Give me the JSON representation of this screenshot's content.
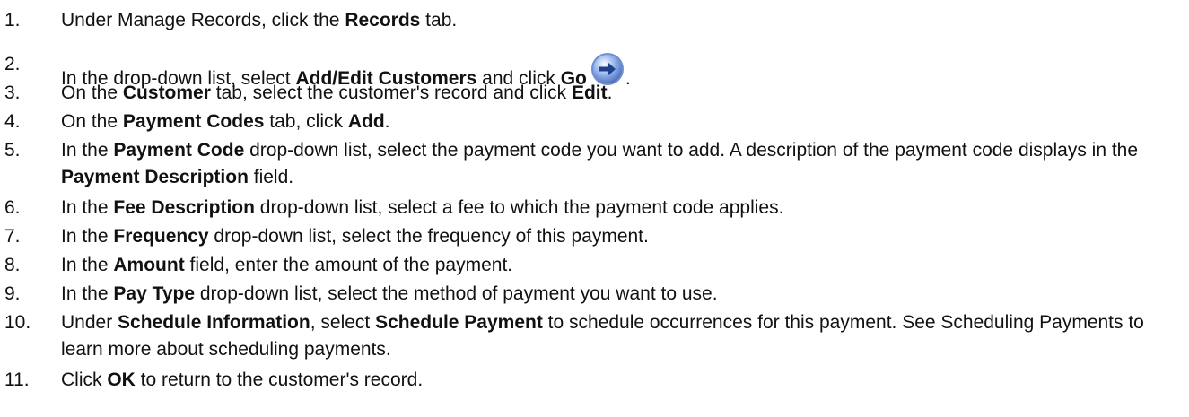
{
  "steps": [
    {
      "number": "1.",
      "parts": [
        {
          "text": "Under Manage Records, click the ",
          "bold": false
        },
        {
          "text": "Records",
          "bold": true
        },
        {
          "text": " tab.",
          "bold": false
        }
      ]
    },
    {
      "number": "2.",
      "parts": [
        {
          "text": "In the drop-down list, select ",
          "bold": false
        },
        {
          "text": "Add/Edit Customers",
          "bold": true
        },
        {
          "text": " and click ",
          "bold": false
        },
        {
          "text": "Go",
          "bold": true
        },
        {
          "icon": "go-arrow-icon"
        },
        {
          "text": ".",
          "bold": false
        }
      ]
    },
    {
      "number": "3.",
      "parts": [
        {
          "text": "On the ",
          "bold": false
        },
        {
          "text": "Customer",
          "bold": true
        },
        {
          "text": " tab, select the customer's record and click ",
          "bold": false
        },
        {
          "text": "Edit",
          "bold": true
        },
        {
          "text": ".",
          "bold": false
        }
      ]
    },
    {
      "number": "4.",
      "parts": [
        {
          "text": "On the ",
          "bold": false
        },
        {
          "text": "Payment Codes",
          "bold": true
        },
        {
          "text": " tab, click ",
          "bold": false
        },
        {
          "text": "Add",
          "bold": true
        },
        {
          "text": ".",
          "bold": false
        }
      ]
    },
    {
      "number": "5.",
      "parts": [
        {
          "text": "In the ",
          "bold": false
        },
        {
          "text": "Payment Code",
          "bold": true
        },
        {
          "text": " drop-down list, select the payment code you want to add. A description of the payment code displays in the ",
          "bold": false
        },
        {
          "text": "Payment Description",
          "bold": true
        },
        {
          "text": " field.",
          "bold": false
        }
      ]
    },
    {
      "number": "6.",
      "parts": [
        {
          "text": "In the ",
          "bold": false
        },
        {
          "text": "Fee Description",
          "bold": true
        },
        {
          "text": " drop-down list, select a fee to which the payment code applies.",
          "bold": false
        }
      ]
    },
    {
      "number": "7.",
      "parts": [
        {
          "text": "In the ",
          "bold": false
        },
        {
          "text": "Frequency",
          "bold": true
        },
        {
          "text": " drop-down list, select the frequency of this payment.",
          "bold": false
        }
      ]
    },
    {
      "number": "8.",
      "parts": [
        {
          "text": "In the ",
          "bold": false
        },
        {
          "text": "Amount",
          "bold": true
        },
        {
          "text": " field, enter the amount of the payment.",
          "bold": false
        }
      ]
    },
    {
      "number": "9.",
      "parts": [
        {
          "text": "In the ",
          "bold": false
        },
        {
          "text": "Pay Type",
          "bold": true
        },
        {
          "text": " drop-down list, select the method of payment you want to use.",
          "bold": false
        }
      ]
    },
    {
      "number": "10.",
      "parts": [
        {
          "text": "Under ",
          "bold": false
        },
        {
          "text": "Schedule Information",
          "bold": true
        },
        {
          "text": ", select ",
          "bold": false
        },
        {
          "text": "Schedule Payment",
          "bold": true
        },
        {
          "text": " to schedule occurrences for this payment. See Scheduling Payments to learn more about scheduling payments.",
          "bold": false
        }
      ]
    },
    {
      "number": "11.",
      "parts": [
        {
          "text": "Click ",
          "bold": false
        },
        {
          "text": "OK",
          "bold": true
        },
        {
          "text": " to return to the customer's record.",
          "bold": false
        }
      ]
    }
  ],
  "icon_colors": {
    "go_ring": "#6f8fd0",
    "go_fill": "#8fb0ec",
    "go_arrow": "#1f3f8f"
  }
}
